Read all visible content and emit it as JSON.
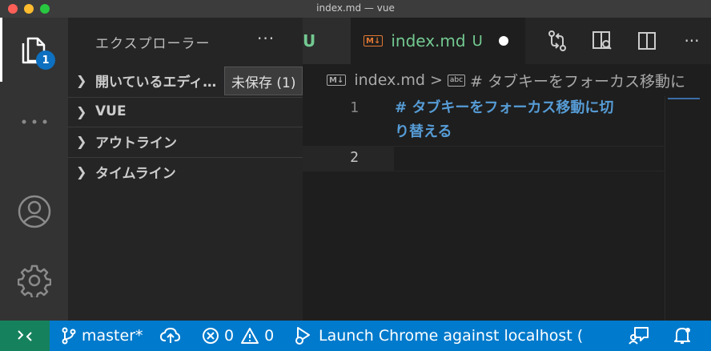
{
  "window": {
    "title": "index.md — vue"
  },
  "activity_bar": {
    "explorer_badge": "1"
  },
  "sidebar": {
    "title": "エクスプローラー",
    "more": "···",
    "sections": [
      {
        "label": "開いているエディ…"
      },
      {
        "label": "VUE"
      },
      {
        "label": "アウトライン"
      },
      {
        "label": "タイムライン"
      }
    ],
    "tooltip": "未保存 (1)"
  },
  "tabs": {
    "previous_tab_fragment": "U",
    "active": {
      "icon": "M↓",
      "name": "index.md",
      "status": "U"
    },
    "more": "···"
  },
  "breadcrumb": {
    "icon": "M↓",
    "file": "index.md",
    "separator": ">",
    "symbol_icon": "abc",
    "symbol": "# タブキーをフォーカス移動に"
  },
  "editor": {
    "lines": [
      {
        "number": "1",
        "text_line1": "#  タブキーをフォーカス移動に切",
        "text_line2": "り替える"
      },
      {
        "number": "2",
        "text": ""
      }
    ]
  },
  "statusbar": {
    "branch": "master*",
    "errors": "0",
    "warnings": "0",
    "launch": "Launch Chrome against localhost ("
  }
}
